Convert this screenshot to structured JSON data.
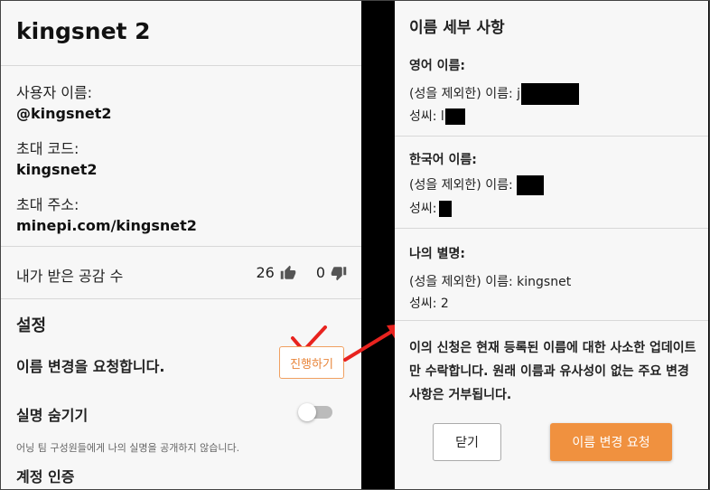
{
  "profile": {
    "title": "kingsnet 2",
    "username_label": "사용자 이름:",
    "username": "@kingsnet2",
    "invite_code_label": "초대 코드:",
    "invite_code": "kingsnet2",
    "invite_url_label": "초대 주소:",
    "invite_url": "minepi.com/kingsnet2",
    "likes_label": "내가 받은 공감 수",
    "likes_up": "26",
    "likes_down": "0"
  },
  "settings": {
    "title": "설정",
    "rename_label": "이름 변경을 요청합니다.",
    "proceed_button": "진행하기",
    "hide_realname_label": "실명 숨기기",
    "hide_realname_on": false,
    "hide_realname_hint": "어닝 팀 구성원들에게 나의 실명을 공개하지 않습니다.",
    "verify_label": "계정 인증"
  },
  "details": {
    "title": "이름 세부 사항",
    "english_heading": "영어 이름:",
    "english_given_label": "(성을 제외한) 이름: j",
    "english_surname_label": "성씨: l",
    "korean_heading": "한국어 이름:",
    "korean_given_label": "(성을 제외한) 이름:",
    "korean_surname_label": "성씨:",
    "nickname_heading": "나의 별명:",
    "nickname_given": "(성을 제외한) 이름: kingsnet",
    "nickname_surname": "성씨: 2",
    "notice": "이의 신청은 현재 등록된 이름에 대한 사소한 업데이트만 수락합니다. 원래 이름과 유사성이 없는 주요 변경 사항은 거부됩니다.",
    "close_button": "닫기",
    "request_button": "이름 변경 요청"
  },
  "colors": {
    "accent": "#f0913f",
    "annotation_red": "#e8231f"
  }
}
